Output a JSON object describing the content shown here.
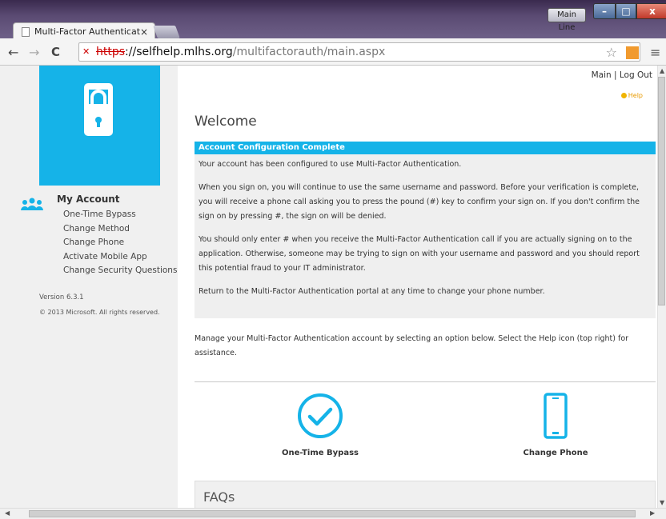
{
  "window": {
    "profile_label": "Main Line",
    "tab_title": "Multi-Factor Authenticatio",
    "tab_close": "×"
  },
  "toolbar": {
    "back": "←",
    "forward": "→",
    "reload": "C",
    "url_scheme": "https",
    "url_host": "://selfhelp.mlhs.org",
    "url_path": "/multifactorauth/main.aspx",
    "star": "☆",
    "menu": "≡"
  },
  "sidebar": {
    "account_title": "My Account",
    "links": [
      "One-Time Bypass",
      "Change Method",
      "Change Phone",
      "Activate Mobile App",
      "Change Security Questions"
    ],
    "version": "Version 6.3.1",
    "copyright": "© 2013 Microsoft. All rights reserved."
  },
  "main": {
    "nav": "Main | Log Out",
    "help": "Help",
    "welcome": "Welcome",
    "panel_title": "Account Configuration Complete",
    "paragraphs": [
      "Your account has been configured to use Multi-Factor Authentication.",
      "When you sign on, you will continue to use the same username and password. Before your verification is complete, you will receive a phone call asking you to press the pound (#) key to confirm your sign on. If you don't confirm the sign on by pressing #, the sign on will be denied.",
      "You should only enter # when you receive the Multi-Factor Authentication call if you are actually signing on to the application. Otherwise, someone may be trying to sign on with your username and password and you should report this potential fraud to your IT administrator.",
      "Return to the Multi-Factor Authentication portal at any time to change your phone number."
    ],
    "manage_text": "Manage your Multi-Factor Authentication account by selecting an option below. Select the Help icon (top right) for assistance.",
    "bypass_label": "One-Time Bypass",
    "change_phone_label": "Change Phone",
    "faqs": "FAQs"
  },
  "colors": {
    "accent": "#15b3e8",
    "chrome": "#5a4a72"
  },
  "icons": [
    "document-icon",
    "lock-warning-icon",
    "star-icon",
    "extension-icon",
    "menu-icon",
    "phone-lock-icon",
    "users-icon",
    "help-icon",
    "checkmark-circle-icon",
    "mobile-phone-icon"
  ]
}
